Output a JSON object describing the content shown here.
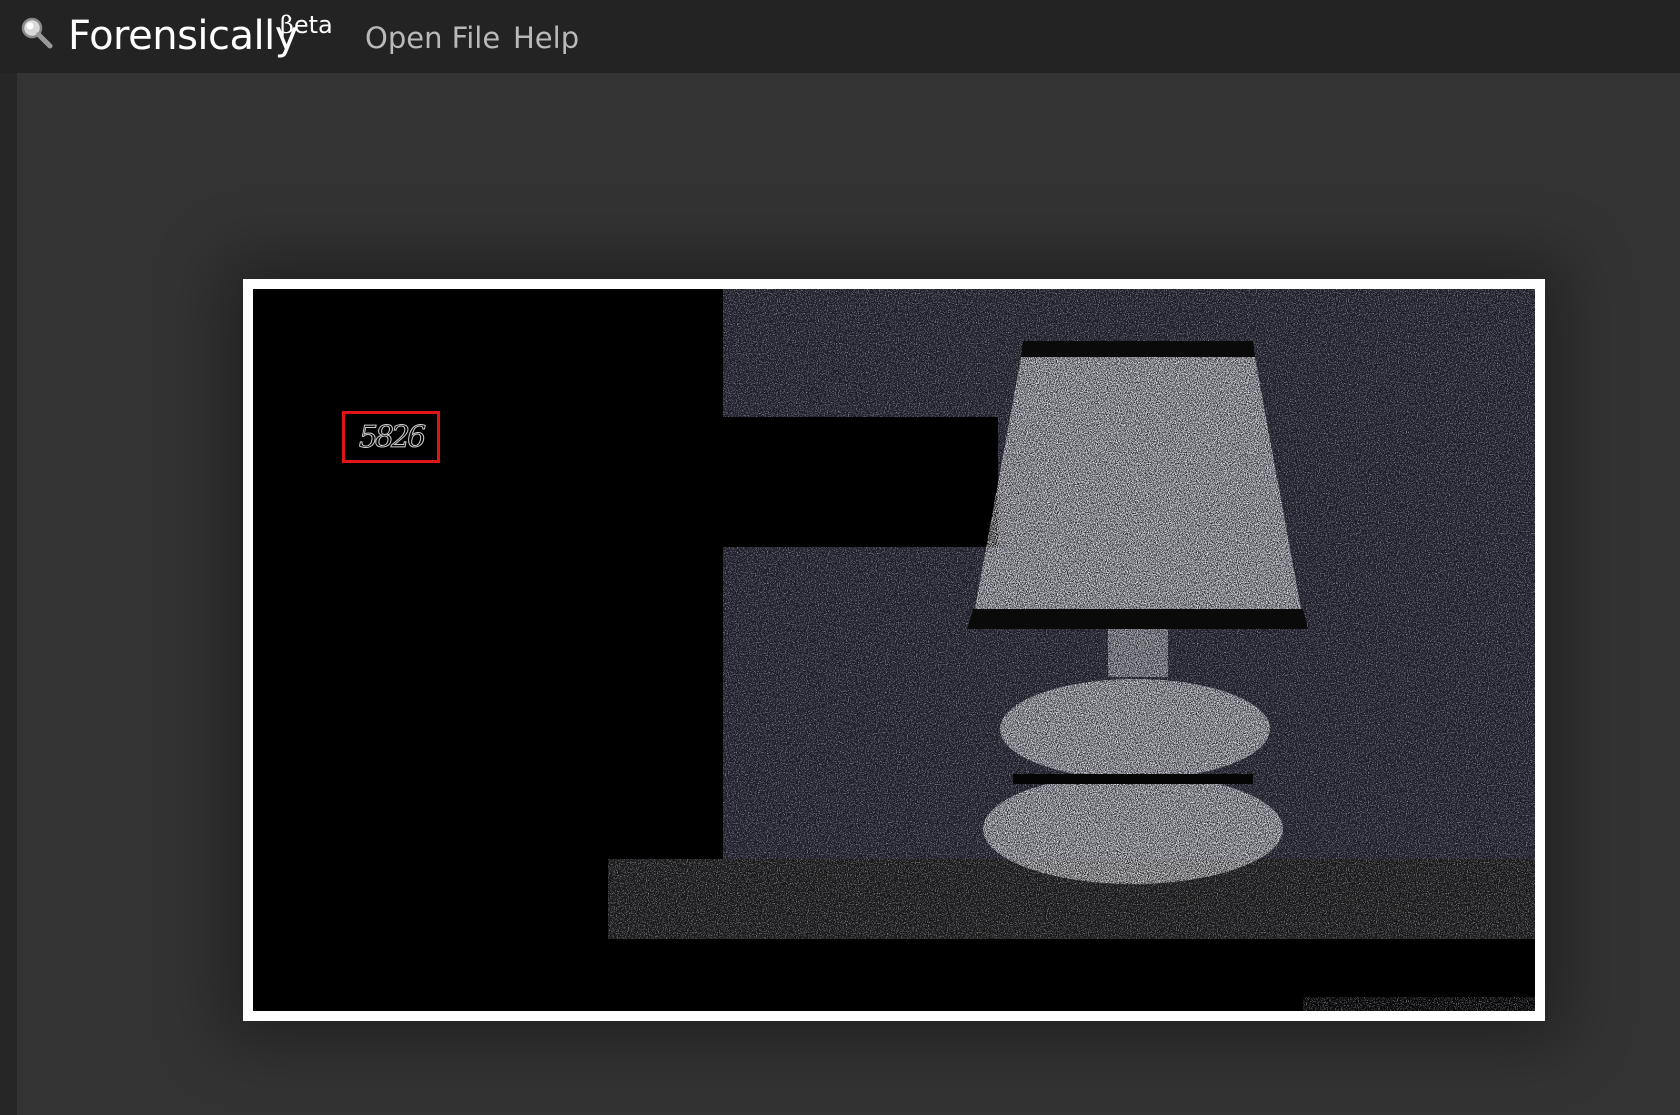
{
  "app": {
    "name": "Forensically",
    "badge": "Beta"
  },
  "nav": {
    "open_file": "Open File",
    "help": "Help"
  },
  "image": {
    "highlight_text": "5826"
  },
  "colors": {
    "topbar": "#232323",
    "workspace": "#333333",
    "frame": "#ffffff",
    "highlight_border": "#e01515"
  }
}
